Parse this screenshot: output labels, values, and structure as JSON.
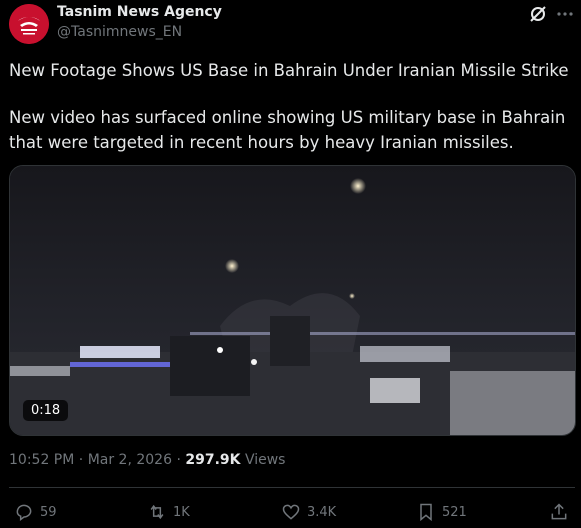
{
  "author": {
    "name": "Tasnim News Agency",
    "handle": "@Tasnimnews_EN"
  },
  "tweet": {
    "headline": "New Footage Shows US Base in Bahrain Under Iranian Missile Strike",
    "body": "New video has surfaced online showing US military base in Bahrain that were targeted in recent hours by heavy Iranian missiles."
  },
  "media": {
    "duration": "0:18"
  },
  "meta": {
    "time": "10:52 PM",
    "separator": " · ",
    "date": "Mar 2, 2026",
    "views_count": "297.9K",
    "views_label": " Views"
  },
  "actions": {
    "reply_count": "59",
    "repost_count": "1K",
    "like_count": "3.4K",
    "bookmark_count": "521"
  },
  "icons": {
    "grok": "grok-icon",
    "more": "more-icon",
    "reply": "reply-icon",
    "repost": "repost-icon",
    "like": "heart-icon",
    "bookmark": "bookmark-icon",
    "share": "share-icon"
  },
  "colors": {
    "background": "#000000",
    "text_primary": "#e7e9ea",
    "text_secondary": "#71767b",
    "divider": "#2f3336",
    "avatar_brand": "#c8102e"
  }
}
